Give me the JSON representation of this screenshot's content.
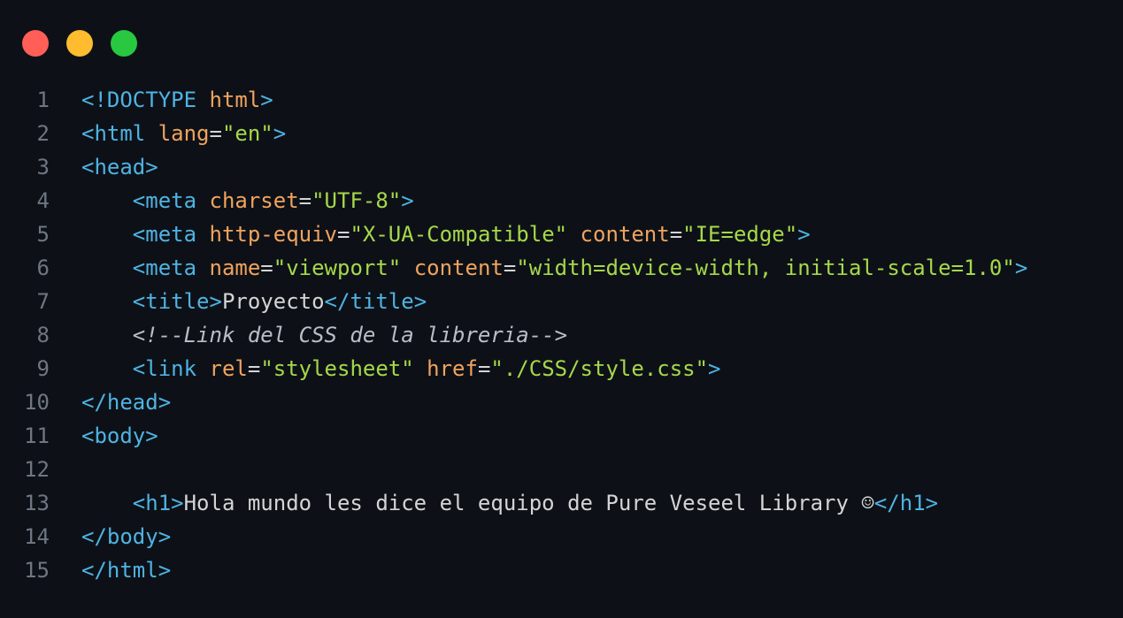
{
  "window": {
    "controls": [
      {
        "name": "close",
        "color": "#ff5f57"
      },
      {
        "name": "minimize",
        "color": "#febc2e"
      },
      {
        "name": "maximize",
        "color": "#28c840"
      }
    ]
  },
  "code": {
    "lines": [
      {
        "n": "1",
        "tokens": [
          [
            "tag",
            "<!DOCTYPE "
          ],
          [
            "attr",
            "html"
          ],
          [
            "tag",
            ">"
          ]
        ]
      },
      {
        "n": "2",
        "tokens": [
          [
            "tag",
            "<html "
          ],
          [
            "attr",
            "lang"
          ],
          [
            "eq",
            "="
          ],
          [
            "str",
            "\"en\""
          ],
          [
            "tag",
            ">"
          ]
        ]
      },
      {
        "n": "3",
        "tokens": [
          [
            "tag",
            "<head>"
          ]
        ]
      },
      {
        "n": "4",
        "tokens": [
          [
            "txt",
            "    "
          ],
          [
            "tag",
            "<meta "
          ],
          [
            "attr",
            "charset"
          ],
          [
            "eq",
            "="
          ],
          [
            "str",
            "\"UTF-8\""
          ],
          [
            "tag",
            ">"
          ]
        ]
      },
      {
        "n": "5",
        "tokens": [
          [
            "txt",
            "    "
          ],
          [
            "tag",
            "<meta "
          ],
          [
            "attr",
            "http-equiv"
          ],
          [
            "eq",
            "="
          ],
          [
            "str",
            "\"X-UA-Compatible\""
          ],
          [
            "txt",
            " "
          ],
          [
            "attr",
            "content"
          ],
          [
            "eq",
            "="
          ],
          [
            "str",
            "\"IE=edge\""
          ],
          [
            "tag",
            ">"
          ]
        ]
      },
      {
        "n": "6",
        "tokens": [
          [
            "txt",
            "    "
          ],
          [
            "tag",
            "<meta "
          ],
          [
            "attr",
            "name"
          ],
          [
            "eq",
            "="
          ],
          [
            "str",
            "\"viewport\""
          ],
          [
            "txt",
            " "
          ],
          [
            "attr",
            "content"
          ],
          [
            "eq",
            "="
          ],
          [
            "str",
            "\"width=device-width, initial-scale=1.0\""
          ],
          [
            "tag",
            ">"
          ]
        ]
      },
      {
        "n": "7",
        "tokens": [
          [
            "txt",
            "    "
          ],
          [
            "tag",
            "<title>"
          ],
          [
            "txt",
            "Proyecto"
          ],
          [
            "tag",
            "</title>"
          ]
        ]
      },
      {
        "n": "8",
        "tokens": [
          [
            "txt",
            "    "
          ],
          [
            "cmt",
            "<!--Link del CSS de la libreria-->"
          ]
        ]
      },
      {
        "n": "9",
        "tokens": [
          [
            "txt",
            "    "
          ],
          [
            "tag",
            "<link "
          ],
          [
            "attr",
            "rel"
          ],
          [
            "eq",
            "="
          ],
          [
            "str",
            "\"stylesheet\""
          ],
          [
            "txt",
            " "
          ],
          [
            "attr",
            "href"
          ],
          [
            "eq",
            "="
          ],
          [
            "str",
            "\"./CSS/style.css\""
          ],
          [
            "tag",
            ">"
          ]
        ]
      },
      {
        "n": "10",
        "tokens": [
          [
            "tag",
            "</head>"
          ]
        ]
      },
      {
        "n": "11",
        "tokens": [
          [
            "tag",
            "<body>"
          ]
        ]
      },
      {
        "n": "12",
        "tokens": []
      },
      {
        "n": "13",
        "tokens": [
          [
            "txt",
            "    "
          ],
          [
            "tag",
            "<h1>"
          ],
          [
            "txt",
            "Hola mundo les dice el equipo de Pure Veseel Library ☺"
          ],
          [
            "tag",
            "</h1>"
          ]
        ]
      },
      {
        "n": "14",
        "tokens": [
          [
            "tag",
            "</body>"
          ]
        ]
      },
      {
        "n": "15",
        "tokens": [
          [
            "tag",
            "</html>"
          ]
        ]
      }
    ]
  }
}
